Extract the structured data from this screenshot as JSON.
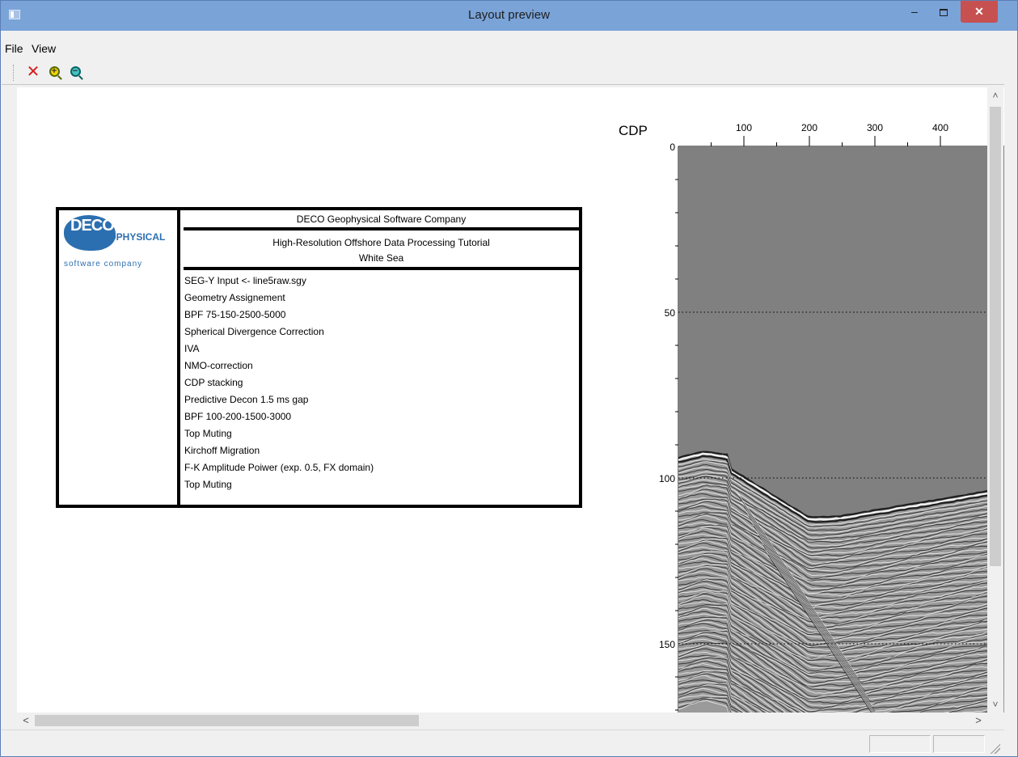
{
  "window": {
    "title": "Layout preview",
    "controls": {
      "minimize": "–",
      "maximize": "□",
      "close": "✕"
    }
  },
  "menu": {
    "items": [
      "File",
      "View"
    ]
  },
  "toolbar": {
    "delete_icon": "close-x-icon",
    "zoom_in_icon": "zoom-in-icon",
    "zoom_out_icon": "zoom-out-icon",
    "delete_glyph": "✕"
  },
  "header": {
    "logo_text": "DECO",
    "logo_sub": "GEOPHYSICAL",
    "logo_tag": "software company",
    "company": "DECO Geophysical Software Company",
    "project_line1": "High-Resolution Offshore Data Processing Tutorial",
    "project_line2": "White Sea",
    "steps": [
      "SEG-Y Input <- line5raw.sgy",
      "Geometry Assignement",
      "BPF 75-150-2500-5000",
      "Spherical Divergence Correction",
      "IVA",
      "NMO-correction",
      "CDP stacking",
      "Predictive Decon 1.5 ms gap",
      "BPF 100-200-1500-3000",
      "Top Muting",
      "Kirchoff Migration",
      "F-K Amplitude Poiwer (exp. 0.5, FX domain)",
      "Top Muting"
    ]
  },
  "section": {
    "x_axis_label": "CDP",
    "x_ticks": [
      "100",
      "200",
      "300",
      "400"
    ],
    "y_ticks": [
      "0",
      "50",
      "100",
      "150"
    ]
  },
  "scroll": {
    "up": "˄",
    "down": "˅",
    "left": "<",
    "right": ">"
  },
  "colors": {
    "titlebar": "#7aa3d8",
    "close_button": "#c75050",
    "seismic_background": "#808080"
  }
}
